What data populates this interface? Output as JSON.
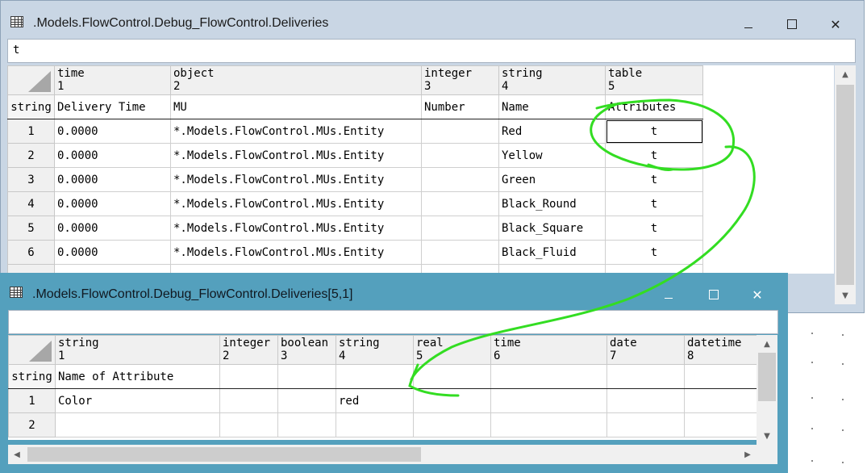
{
  "window1": {
    "title": ".Models.FlowControl.Debug_FlowControl.Deliveries",
    "entry_value": "t",
    "columns": [
      {
        "type": "time",
        "index": "1",
        "name": "Delivery Time"
      },
      {
        "type": "object",
        "index": "2",
        "name": "MU"
      },
      {
        "type": "integer",
        "index": "3",
        "name": "Number"
      },
      {
        "type": "string",
        "index": "4",
        "name": "Name"
      },
      {
        "type": "table",
        "index": "5",
        "name": "Attributes"
      }
    ],
    "rowhead_label": "string",
    "rows": [
      {
        "num": "1",
        "cells": [
          "0.0000",
          "*.Models.FlowControl.MUs.Entity",
          "",
          "Red",
          "t"
        ]
      },
      {
        "num": "2",
        "cells": [
          "0.0000",
          "*.Models.FlowControl.MUs.Entity",
          "",
          "Yellow",
          "t"
        ]
      },
      {
        "num": "3",
        "cells": [
          "0.0000",
          "*.Models.FlowControl.MUs.Entity",
          "",
          "Green",
          "t"
        ]
      },
      {
        "num": "4",
        "cells": [
          "0.0000",
          "*.Models.FlowControl.MUs.Entity",
          "",
          "Black_Round",
          "t"
        ]
      },
      {
        "num": "5",
        "cells": [
          "0.0000",
          "*.Models.FlowControl.MUs.Entity",
          "",
          "Black_Square",
          "t"
        ]
      },
      {
        "num": "6",
        "cells": [
          "0.0000",
          "*.Models.FlowControl.MUs.Entity",
          "",
          "Black_Fluid",
          "t"
        ]
      }
    ]
  },
  "window2": {
    "title": ".Models.FlowControl.Debug_FlowControl.Deliveries[5,1]",
    "entry_value": "",
    "columns": [
      {
        "type": "string",
        "index": "1",
        "name": "Name of Attribute"
      },
      {
        "type": "integer",
        "index": "2",
        "name": ""
      },
      {
        "type": "boolean",
        "index": "3",
        "name": ""
      },
      {
        "type": "string",
        "index": "4",
        "name": ""
      },
      {
        "type": "real",
        "index": "5",
        "name": ""
      },
      {
        "type": "time",
        "index": "6",
        "name": ""
      },
      {
        "type": "date",
        "index": "7",
        "name": ""
      },
      {
        "type": "datetime",
        "index": "8",
        "name": ""
      }
    ],
    "rowhead_label": "string",
    "rows": [
      {
        "num": "1",
        "cells": [
          "Color",
          "",
          "",
          "red",
          "",
          "",
          "",
          ""
        ]
      },
      {
        "num": "2",
        "cells": [
          "",
          "",
          "",
          "",
          "",
          "",
          "",
          ""
        ]
      }
    ]
  },
  "controls": {
    "minimize": "−",
    "maximize": "☐",
    "close": "✕",
    "arrow_up": "▲",
    "arrow_down": "▼",
    "arrow_left": "◀",
    "arrow_right": "▶"
  },
  "colors": {
    "window1_frame": "#c9d6e4",
    "window2_titlebar": "#54a0bd",
    "annotation": "#33dd22"
  }
}
